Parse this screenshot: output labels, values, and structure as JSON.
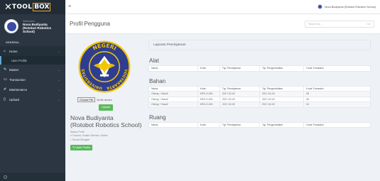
{
  "logo": {
    "text": "TOOL",
    "box": "BOX"
  },
  "sidebar": {
    "welcome": "Welcome,",
    "user_name": "Nova Budiyanta (Rotobot Robotics School)",
    "section_header": "GENERAL",
    "items": [
      {
        "label": "Home",
        "icon": "home-icon",
        "glyph": "⌂"
      },
      {
        "label": "Master",
        "icon": "edit-icon",
        "glyph": "✎"
      },
      {
        "label": "Transaction",
        "icon": "desktop-icon",
        "glyph": "▭"
      },
      {
        "label": "Maintenance",
        "icon": "wrench-icon",
        "glyph": "✐"
      },
      {
        "label": "Upload",
        "icon": "file-icon",
        "glyph": "▯"
      }
    ],
    "sub_item": "User Profile"
  },
  "topbar": {
    "user_name": "Nova Budiyanta (Rotobot Robotics School)"
  },
  "header": {
    "title": "Profil Pengguna",
    "search_placeholder": "Search for...",
    "search_button": "Go!"
  },
  "profile": {
    "choose_file": "Choose File",
    "no_file": "No file chosen",
    "upload": "Upload",
    "name": "Nova Budiyanta (Rotobot Robotics School)",
    "name_line1": "Nova Budiyanta",
    "name_line2": "(Rotobot Robotics School)",
    "status": "Status Profil",
    "address": "Trumuh, Kralan Sleman, Klaten",
    "job": "Teknisi Bengkel",
    "edit": "Ubah Profile"
  },
  "loan": {
    "title": "Laporan Peminjaman",
    "alat": {
      "title": "Alat",
      "columns": [
        "Nama",
        "Kode",
        "Tgl. Peminjaman",
        "Tgl. Pengembalian",
        "Kode Transaksi"
      ],
      "rows": []
    },
    "bahan": {
      "title": "Bahan",
      "columns": [
        "Nama",
        "Kode",
        "Tgl. Peminjaman",
        "Tgl. Pengembalian",
        "Kode Transaksi"
      ],
      "rows": [
        [
          "Obeng + Baut2",
          "KRS-O-001",
          "2017-02-02",
          "2017-02-02",
          "59"
        ],
        [
          "Obeng + Baut2",
          "KRS-O-001",
          "2017-02-02",
          "2017-02-02",
          "60"
        ],
        [
          "Obeng + Baut2",
          "KRS-O-001",
          "2017-02-02",
          "2017-02-02",
          "61"
        ]
      ]
    },
    "ruang": {
      "title": "Ruang",
      "columns": [
        "Nama",
        "Kode",
        "Tgl. Peminjaman",
        "Tgl. Pengembalian",
        "Kode Transaksi"
      ],
      "rows": []
    }
  },
  "emblem_text": {
    "top": "NEGERI",
    "left": "UNIVERSITAS",
    "right": "YOGYAKARTA"
  },
  "colors": {
    "sidebar": "#2b3642",
    "accent_green": "#5cb85c",
    "emblem_blue": "#2f3d8f",
    "emblem_gold": "#f2c500"
  }
}
